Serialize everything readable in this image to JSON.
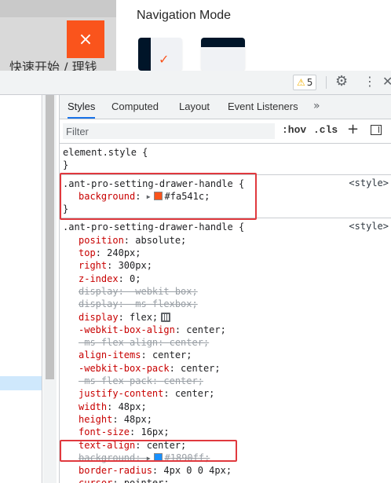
{
  "app": {
    "drawer_title": "Navigation Mode",
    "handle_icon": "×",
    "page_text": "快速开始 / 理钱",
    "colors": {
      "handle": "#fa541c",
      "nav_dark": "#001529"
    }
  },
  "devtools": {
    "warnings": {
      "count": "5"
    },
    "tabs": [
      "Styles",
      "Computed",
      "Layout",
      "Event Listeners"
    ],
    "tab_more": "»",
    "filter": {
      "placeholder": "Filter",
      "value": ""
    },
    "hov_label": ":hov",
    "cls_label": ".cls",
    "rules": [
      {
        "selector": "element.style {",
        "source": "",
        "close": "}",
        "props": []
      },
      {
        "selector": ".ant-pro-setting-drawer-handle {",
        "source": "<style>",
        "close": "}",
        "props": [
          {
            "name": "background",
            "value": "#fa541c;",
            "swatch": "#fa541c",
            "struck": false
          }
        ]
      },
      {
        "selector": ".ant-pro-setting-drawer-handle {",
        "source": "<style>",
        "close": "",
        "props": [
          {
            "name": "position",
            "value": "absolute;",
            "struck": false
          },
          {
            "name": "top",
            "value": "240px;",
            "struck": false
          },
          {
            "name": "right",
            "value": "300px;",
            "struck": false
          },
          {
            "name": "z-index",
            "value": "0;",
            "struck": false
          },
          {
            "name": "display",
            "value": "-webkit-box;",
            "struck": true
          },
          {
            "name": "display",
            "value": "-ms-flexbox;",
            "struck": true
          },
          {
            "name": "display",
            "value": "flex;",
            "struck": false,
            "flex_icon": true
          },
          {
            "name": "-webkit-box-align",
            "value": "center;",
            "struck": false
          },
          {
            "name": "-ms-flex-align",
            "value": "center;",
            "struck": true
          },
          {
            "name": "align-items",
            "value": "center;",
            "struck": false
          },
          {
            "name": "-webkit-box-pack",
            "value": "center;",
            "struck": false
          },
          {
            "name": "-ms-flex-pack",
            "value": "center;",
            "struck": true
          },
          {
            "name": "justify-content",
            "value": "center;",
            "struck": false
          },
          {
            "name": "width",
            "value": "48px;",
            "struck": false
          },
          {
            "name": "height",
            "value": "48px;",
            "struck": false
          },
          {
            "name": "font-size",
            "value": "16px;",
            "struck": false
          },
          {
            "name": "text-align",
            "value": "center;",
            "struck": false
          },
          {
            "name": "background",
            "value": "#1890ff;",
            "swatch": "#1890ff",
            "struck": true
          },
          {
            "name": "border-radius",
            "value": "4px 0 0 4px;",
            "struck": false
          },
          {
            "name": "cursor",
            "value": "pointer;",
            "struck": false
          }
        ]
      }
    ]
  }
}
